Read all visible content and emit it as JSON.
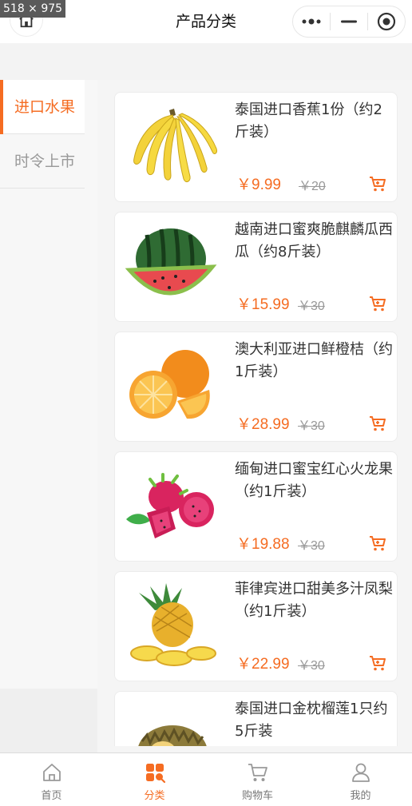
{
  "overlay": {
    "dimensions": "518 × 975"
  },
  "header": {
    "title": "产品分类"
  },
  "sidebar": {
    "items": [
      {
        "label": "进口水果",
        "active": true
      },
      {
        "label": "时令上市",
        "active": false
      }
    ]
  },
  "products": [
    {
      "name": "泰国进口香蕉1份（约2斤装）",
      "price": "￥9.99",
      "old_price": "￥20",
      "image": "banana"
    },
    {
      "name": "越南进口蜜爽脆麒麟瓜西瓜（约8斤装）",
      "price": "￥15.99",
      "old_price": "￥30",
      "image": "watermelon"
    },
    {
      "name": "澳大利亚进口鲜橙桔（约1斤装）",
      "price": "￥28.99",
      "old_price": "￥30",
      "image": "orange"
    },
    {
      "name": "缅甸进口蜜宝红心火龙果（约1斤装）",
      "price": "￥19.88",
      "old_price": "￥30",
      "image": "dragon-fruit"
    },
    {
      "name": "菲律宾进口甜美多汁凤梨（约1斤装）",
      "price": "￥22.99",
      "old_price": "￥30",
      "image": "pineapple"
    },
    {
      "name": "泰国进口金枕榴莲1只约5斤装",
      "price": "",
      "old_price": "",
      "image": "durian"
    }
  ],
  "tabbar": {
    "items": [
      {
        "label": "首页",
        "icon": "home-icon",
        "active": false
      },
      {
        "label": "分类",
        "icon": "category-icon",
        "active": true
      },
      {
        "label": "购物车",
        "icon": "cart-icon",
        "active": false
      },
      {
        "label": "我的",
        "icon": "user-icon",
        "active": false
      }
    ]
  },
  "colors": {
    "accent": "#f56c22",
    "text": "#333333",
    "muted": "#999999"
  }
}
